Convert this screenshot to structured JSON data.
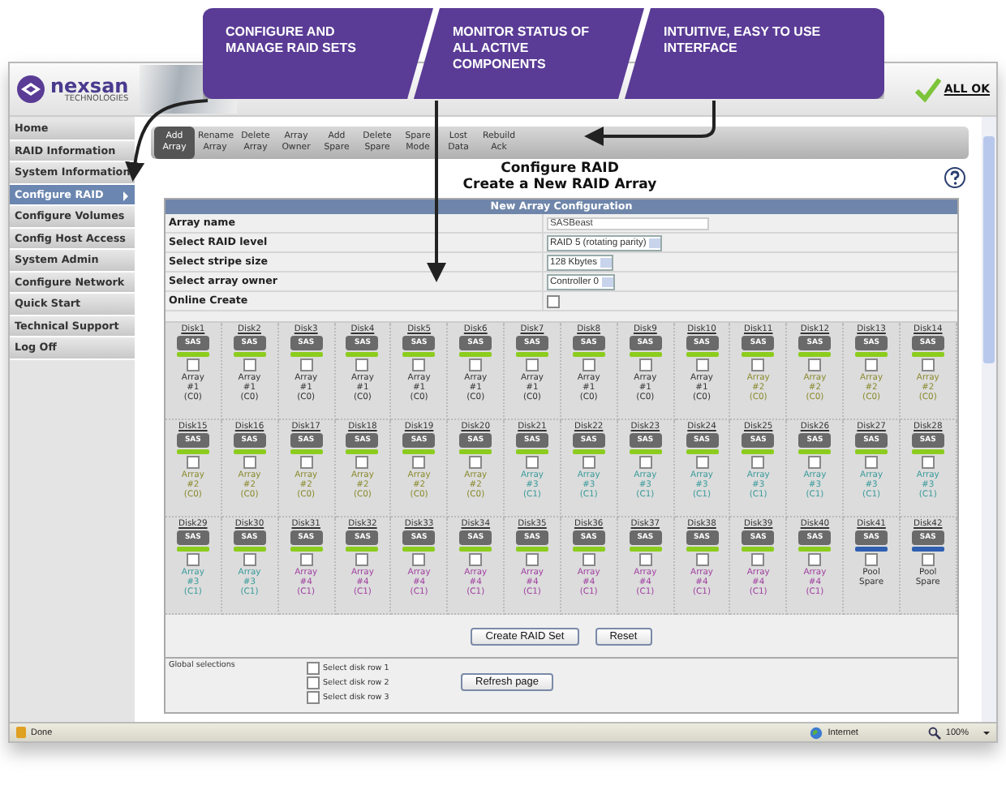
{
  "callouts": [
    "CONFIGURE AND MANAGE RAID SETS",
    "MONITOR STATUS OF ALL ACTIVE COMPONENTS",
    "INTUITIVE, EASY TO USE INTERFACE"
  ],
  "header": {
    "logo": "nexsan",
    "logo_sub": "TECHNOLOGIES",
    "status": "ALL OK"
  },
  "sidebar": {
    "items": [
      {
        "label": "Home",
        "selected": false
      },
      {
        "label": "RAID Information",
        "selected": false
      },
      {
        "label": "System Information",
        "selected": false
      },
      {
        "label": "Configure RAID",
        "selected": true
      },
      {
        "label": "Configure Volumes",
        "selected": false
      },
      {
        "label": "Config Host Access",
        "selected": false
      },
      {
        "label": "System Admin",
        "selected": false
      },
      {
        "label": "Configure Network",
        "selected": false
      },
      {
        "label": "Quick Start",
        "selected": false
      },
      {
        "label": "Technical Support",
        "selected": false
      },
      {
        "label": "Log Off",
        "selected": false
      }
    ]
  },
  "toolbar": [
    {
      "label": "Add Array",
      "selected": true
    },
    {
      "label": "Rename Array",
      "selected": false
    },
    {
      "label": "Delete Array",
      "selected": false
    },
    {
      "label": "Array Owner",
      "selected": false
    },
    {
      "label": "Add Spare",
      "selected": false
    },
    {
      "label": "Delete Spare",
      "selected": false
    },
    {
      "label": "Spare Mode",
      "selected": false
    },
    {
      "label": "Lost Data",
      "selected": false
    },
    {
      "label": "Rebuild Ack",
      "selected": false
    }
  ],
  "title": "Configure RAID",
  "subtitle": "Create a New RAID Array",
  "config": {
    "heading": "New Array Configuration",
    "rows": [
      {
        "label": "Array name",
        "kind": "text",
        "value": "SASBeast"
      },
      {
        "label": "Select RAID level",
        "kind": "select",
        "value": "RAID 5 (rotating parity)"
      },
      {
        "label": "Select stripe size",
        "kind": "select",
        "value": "128 Kbytes"
      },
      {
        "label": "Select array owner",
        "kind": "select",
        "value": "Controller 0"
      },
      {
        "label": "Online Create",
        "kind": "checkbox",
        "checked": false
      }
    ]
  },
  "disks": [
    {
      "label": "Disk1",
      "badge": "SAS",
      "kind": "member",
      "checked": false,
      "status": [
        "Array",
        "#1",
        "(C0)"
      ],
      "color": "#333333"
    },
    {
      "label": "Disk2",
      "badge": "SAS",
      "kind": "member",
      "checked": false,
      "status": [
        "Array",
        "#1",
        "(C0)"
      ],
      "color": "#333333"
    },
    {
      "label": "Disk3",
      "badge": "SAS",
      "kind": "member",
      "checked": false,
      "status": [
        "Array",
        "#1",
        "(C0)"
      ],
      "color": "#333333"
    },
    {
      "label": "Disk4",
      "badge": "SAS",
      "kind": "member",
      "checked": false,
      "status": [
        "Array",
        "#1",
        "(C0)"
      ],
      "color": "#333333"
    },
    {
      "label": "Disk5",
      "badge": "SAS",
      "kind": "member",
      "checked": false,
      "status": [
        "Array",
        "#1",
        "(C0)"
      ],
      "color": "#333333"
    },
    {
      "label": "Disk6",
      "badge": "SAS",
      "kind": "member",
      "checked": false,
      "status": [
        "Array",
        "#1",
        "(C0)"
      ],
      "color": "#333333"
    },
    {
      "label": "Disk7",
      "badge": "SAS",
      "kind": "member",
      "checked": false,
      "status": [
        "Array",
        "#1",
        "(C0)"
      ],
      "color": "#333333"
    },
    {
      "label": "Disk8",
      "badge": "SAS",
      "kind": "member",
      "checked": false,
      "status": [
        "Array",
        "#1",
        "(C0)"
      ],
      "color": "#333333"
    },
    {
      "label": "Disk9",
      "badge": "SAS",
      "kind": "member",
      "checked": false,
      "status": [
        "Array",
        "#1",
        "(C0)"
      ],
      "color": "#333333"
    },
    {
      "label": "Disk10",
      "badge": "SAS",
      "kind": "member",
      "checked": false,
      "status": [
        "Array",
        "#1",
        "(C0)"
      ],
      "color": "#333333"
    },
    {
      "label": "Disk11",
      "badge": "SAS",
      "kind": "member",
      "checked": false,
      "status": [
        "Array",
        "#2",
        "(C0)"
      ],
      "color": "#8a8a2e"
    },
    {
      "label": "Disk12",
      "badge": "SAS",
      "kind": "member",
      "checked": false,
      "status": [
        "Array",
        "#2",
        "(C0)"
      ],
      "color": "#8a8a2e"
    },
    {
      "label": "Disk13",
      "badge": "SAS",
      "kind": "member",
      "checked": false,
      "status": [
        "Array",
        "#2",
        "(C0)"
      ],
      "color": "#8a8a2e"
    },
    {
      "label": "Disk14",
      "badge": "SAS",
      "kind": "member",
      "checked": false,
      "status": [
        "Array",
        "#2",
        "(C0)"
      ],
      "color": "#8a8a2e"
    },
    {
      "label": "Disk15",
      "badge": "SAS",
      "kind": "member",
      "checked": false,
      "status": [
        "Array",
        "#2",
        "(C0)"
      ],
      "color": "#8a8a2e"
    },
    {
      "label": "Disk16",
      "badge": "SAS",
      "kind": "member",
      "checked": false,
      "status": [
        "Array",
        "#2",
        "(C0)"
      ],
      "color": "#8a8a2e"
    },
    {
      "label": "Disk17",
      "badge": "SAS",
      "kind": "member",
      "checked": false,
      "status": [
        "Array",
        "#2",
        "(C0)"
      ],
      "color": "#8a8a2e"
    },
    {
      "label": "Disk18",
      "badge": "SAS",
      "kind": "member",
      "checked": false,
      "status": [
        "Array",
        "#2",
        "(C0)"
      ],
      "color": "#8a8a2e"
    },
    {
      "label": "Disk19",
      "badge": "SAS",
      "kind": "member",
      "checked": false,
      "status": [
        "Array",
        "#2",
        "(C0)"
      ],
      "color": "#8a8a2e"
    },
    {
      "label": "Disk20",
      "badge": "SAS",
      "kind": "member",
      "checked": false,
      "status": [
        "Array",
        "#2",
        "(C0)"
      ],
      "color": "#8a8a2e"
    },
    {
      "label": "Disk21",
      "badge": "SAS",
      "kind": "member",
      "checked": false,
      "status": [
        "Array",
        "#3",
        "(C1)"
      ],
      "color": "#3a9a9a"
    },
    {
      "label": "Disk22",
      "badge": "SAS",
      "kind": "member",
      "checked": false,
      "status": [
        "Array",
        "#3",
        "(C1)"
      ],
      "color": "#3a9a9a"
    },
    {
      "label": "Disk23",
      "badge": "SAS",
      "kind": "member",
      "checked": false,
      "status": [
        "Array",
        "#3",
        "(C1)"
      ],
      "color": "#3a9a9a"
    },
    {
      "label": "Disk24",
      "badge": "SAS",
      "kind": "member",
      "checked": false,
      "status": [
        "Array",
        "#3",
        "(C1)"
      ],
      "color": "#3a9a9a"
    },
    {
      "label": "Disk25",
      "badge": "SAS",
      "kind": "member",
      "checked": false,
      "status": [
        "Array",
        "#3",
        "(C1)"
      ],
      "color": "#3a9a9a"
    },
    {
      "label": "Disk26",
      "badge": "SAS",
      "kind": "member",
      "checked": false,
      "status": [
        "Array",
        "#3",
        "(C1)"
      ],
      "color": "#3a9a9a"
    },
    {
      "label": "Disk27",
      "badge": "SAS",
      "kind": "member",
      "checked": false,
      "status": [
        "Array",
        "#3",
        "(C1)"
      ],
      "color": "#3a9a9a"
    },
    {
      "label": "Disk28",
      "badge": "SAS",
      "kind": "member",
      "checked": false,
      "status": [
        "Array",
        "#3",
        "(C1)"
      ],
      "color": "#3a9a9a"
    },
    {
      "label": "Disk29",
      "badge": "SAS",
      "kind": "member",
      "checked": false,
      "status": [
        "Array",
        "#3",
        "(C1)"
      ],
      "color": "#3a9a9a"
    },
    {
      "label": "Disk30",
      "badge": "SAS",
      "kind": "member",
      "checked": false,
      "status": [
        "Array",
        "#3",
        "(C1)"
      ],
      "color": "#3a9a9a"
    },
    {
      "label": "Disk31",
      "badge": "SAS",
      "kind": "member",
      "checked": false,
      "status": [
        "Array",
        "#4",
        "(C1)"
      ],
      "color": "#a040a0"
    },
    {
      "label": "Disk32",
      "badge": "SAS",
      "kind": "member",
      "checked": false,
      "status": [
        "Array",
        "#4",
        "(C1)"
      ],
      "color": "#a040a0"
    },
    {
      "label": "Disk33",
      "badge": "SAS",
      "kind": "member",
      "checked": false,
      "status": [
        "Array",
        "#4",
        "(C1)"
      ],
      "color": "#a040a0"
    },
    {
      "label": "Disk34",
      "badge": "SAS",
      "kind": "member",
      "checked": false,
      "status": [
        "Array",
        "#4",
        "(C1)"
      ],
      "color": "#a040a0"
    },
    {
      "label": "Disk35",
      "badge": "SAS",
      "kind": "member",
      "checked": false,
      "status": [
        "Array",
        "#4",
        "(C1)"
      ],
      "color": "#a040a0"
    },
    {
      "label": "Disk36",
      "badge": "SAS",
      "kind": "member",
      "checked": false,
      "status": [
        "Array",
        "#4",
        "(C1)"
      ],
      "color": "#a040a0"
    },
    {
      "label": "Disk37",
      "badge": "SAS",
      "kind": "member",
      "checked": false,
      "status": [
        "Array",
        "#4",
        "(C1)"
      ],
      "color": "#a040a0"
    },
    {
      "label": "Disk38",
      "badge": "SAS",
      "kind": "member",
      "checked": false,
      "status": [
        "Array",
        "#4",
        "(C1)"
      ],
      "color": "#a040a0"
    },
    {
      "label": "Disk39",
      "badge": "SAS",
      "kind": "member",
      "checked": false,
      "status": [
        "Array",
        "#4",
        "(C1)"
      ],
      "color": "#a040a0"
    },
    {
      "label": "Disk40",
      "badge": "SAS",
      "kind": "member",
      "checked": false,
      "status": [
        "Array",
        "#4",
        "(C1)"
      ],
      "color": "#a040a0"
    },
    {
      "label": "Disk41",
      "badge": "SAS",
      "kind": "spare",
      "checked": false,
      "status": [
        "Pool",
        "Spare"
      ],
      "color": "#333333"
    },
    {
      "label": "Disk42",
      "badge": "SAS",
      "kind": "spare",
      "checked": false,
      "status": [
        "Pool",
        "Spare"
      ],
      "color": "#333333"
    }
  ],
  "actions": [
    "Create RAID Set",
    "Reset"
  ],
  "global": {
    "label": "Global selections",
    "options": [
      {
        "label": "Select disk row 1",
        "checked": false
      },
      {
        "label": "Select disk row 2",
        "checked": false
      },
      {
        "label": "Select disk row 3",
        "checked": false
      }
    ],
    "button": "Refresh page"
  },
  "status_bar": {
    "text": "Done",
    "zone": "Internet",
    "zoom": "100%"
  }
}
